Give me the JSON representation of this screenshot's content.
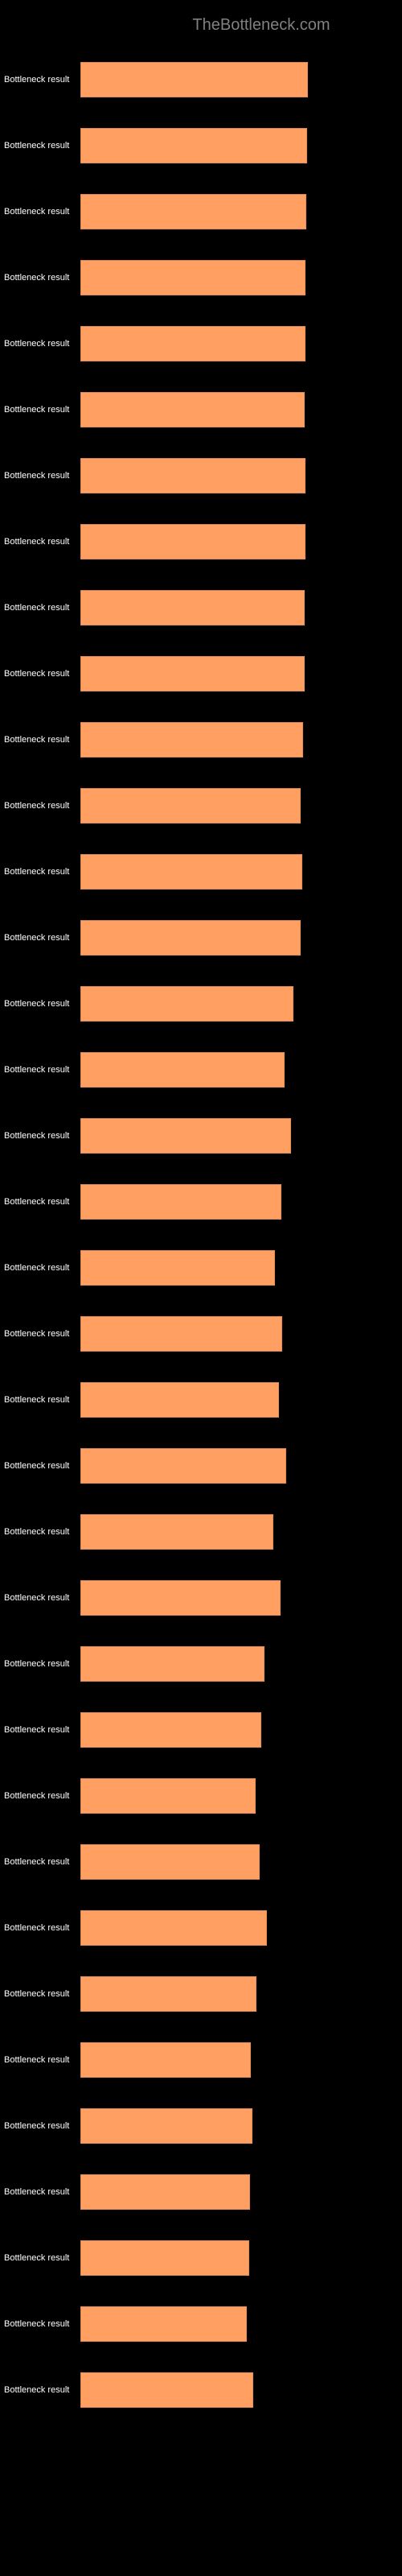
{
  "site_title": "TheBottleneck.com",
  "row_label": "Bottleneck result",
  "chart_data": {
    "type": "bar",
    "title": "",
    "xlabel": "",
    "ylabel": "",
    "xlim": [
      0,
      100
    ],
    "categories_label": "Bottleneck result",
    "series": [
      {
        "value": 74.4,
        "label": "74.4%"
      },
      {
        "value": 74.2,
        "label": "74.2%"
      },
      {
        "value": 73.9,
        "label": "73.9%"
      },
      {
        "value": 73.7,
        "label": "73.7%"
      },
      {
        "value": 73.8,
        "label": "73.8%"
      },
      {
        "value": 73.4,
        "label": "73.4%"
      },
      {
        "value": 73.7,
        "label": "73.7%"
      },
      {
        "value": 73.7,
        "label": "73.7%"
      },
      {
        "value": 73.4,
        "label": "73.4%"
      },
      {
        "value": 73.3,
        "label": "73.3%"
      },
      {
        "value": 72.9,
        "label": "72.9%"
      },
      {
        "value": 72.2,
        "label": "72.2%"
      },
      {
        "value": 72.5,
        "label": "72.5%"
      },
      {
        "value": 72.2,
        "label": "72.2%"
      },
      {
        "value": 69.8,
        "label": "69.8%"
      },
      {
        "value": 66.8,
        "label": "66.8%"
      },
      {
        "value": 68.9,
        "label": "68.9%"
      },
      {
        "value": 65.9,
        "label": "65.9%"
      },
      {
        "value": 63.7,
        "label": "63.7%"
      },
      {
        "value": 66.0,
        "label": "66%"
      },
      {
        "value": 65.0,
        "label": "65%"
      },
      {
        "value": 67.3,
        "label": "67.3%"
      },
      {
        "value": 63.2,
        "label": "63.2%"
      },
      {
        "value": 65.5,
        "label": "65.5%"
      },
      {
        "value": 60.2,
        "label": "60.2%"
      },
      {
        "value": 59.3,
        "label": "59.3%"
      },
      {
        "value": 57.4,
        "label": "57.4%"
      },
      {
        "value": 58.7,
        "label": "58.7%"
      },
      {
        "value": 61.1,
        "label": "61.1%"
      },
      {
        "value": 57.5,
        "label": "57.5%"
      },
      {
        "value": 55.8,
        "label": "55.8%"
      },
      {
        "value": 56.4,
        "label": "56.4%"
      },
      {
        "value": 55.5,
        "label": "55.5%"
      },
      {
        "value": 55.2,
        "label": "55.2%"
      },
      {
        "value": 54.6,
        "label": "54.6%"
      },
      {
        "value": 56.6,
        "label": "56.6%"
      }
    ]
  },
  "colors": {
    "bar_fill": "#ff9f62",
    "bar_border": "#e08850",
    "background": "#000000",
    "label_text": "#ffffff",
    "title_text": "#808080"
  }
}
